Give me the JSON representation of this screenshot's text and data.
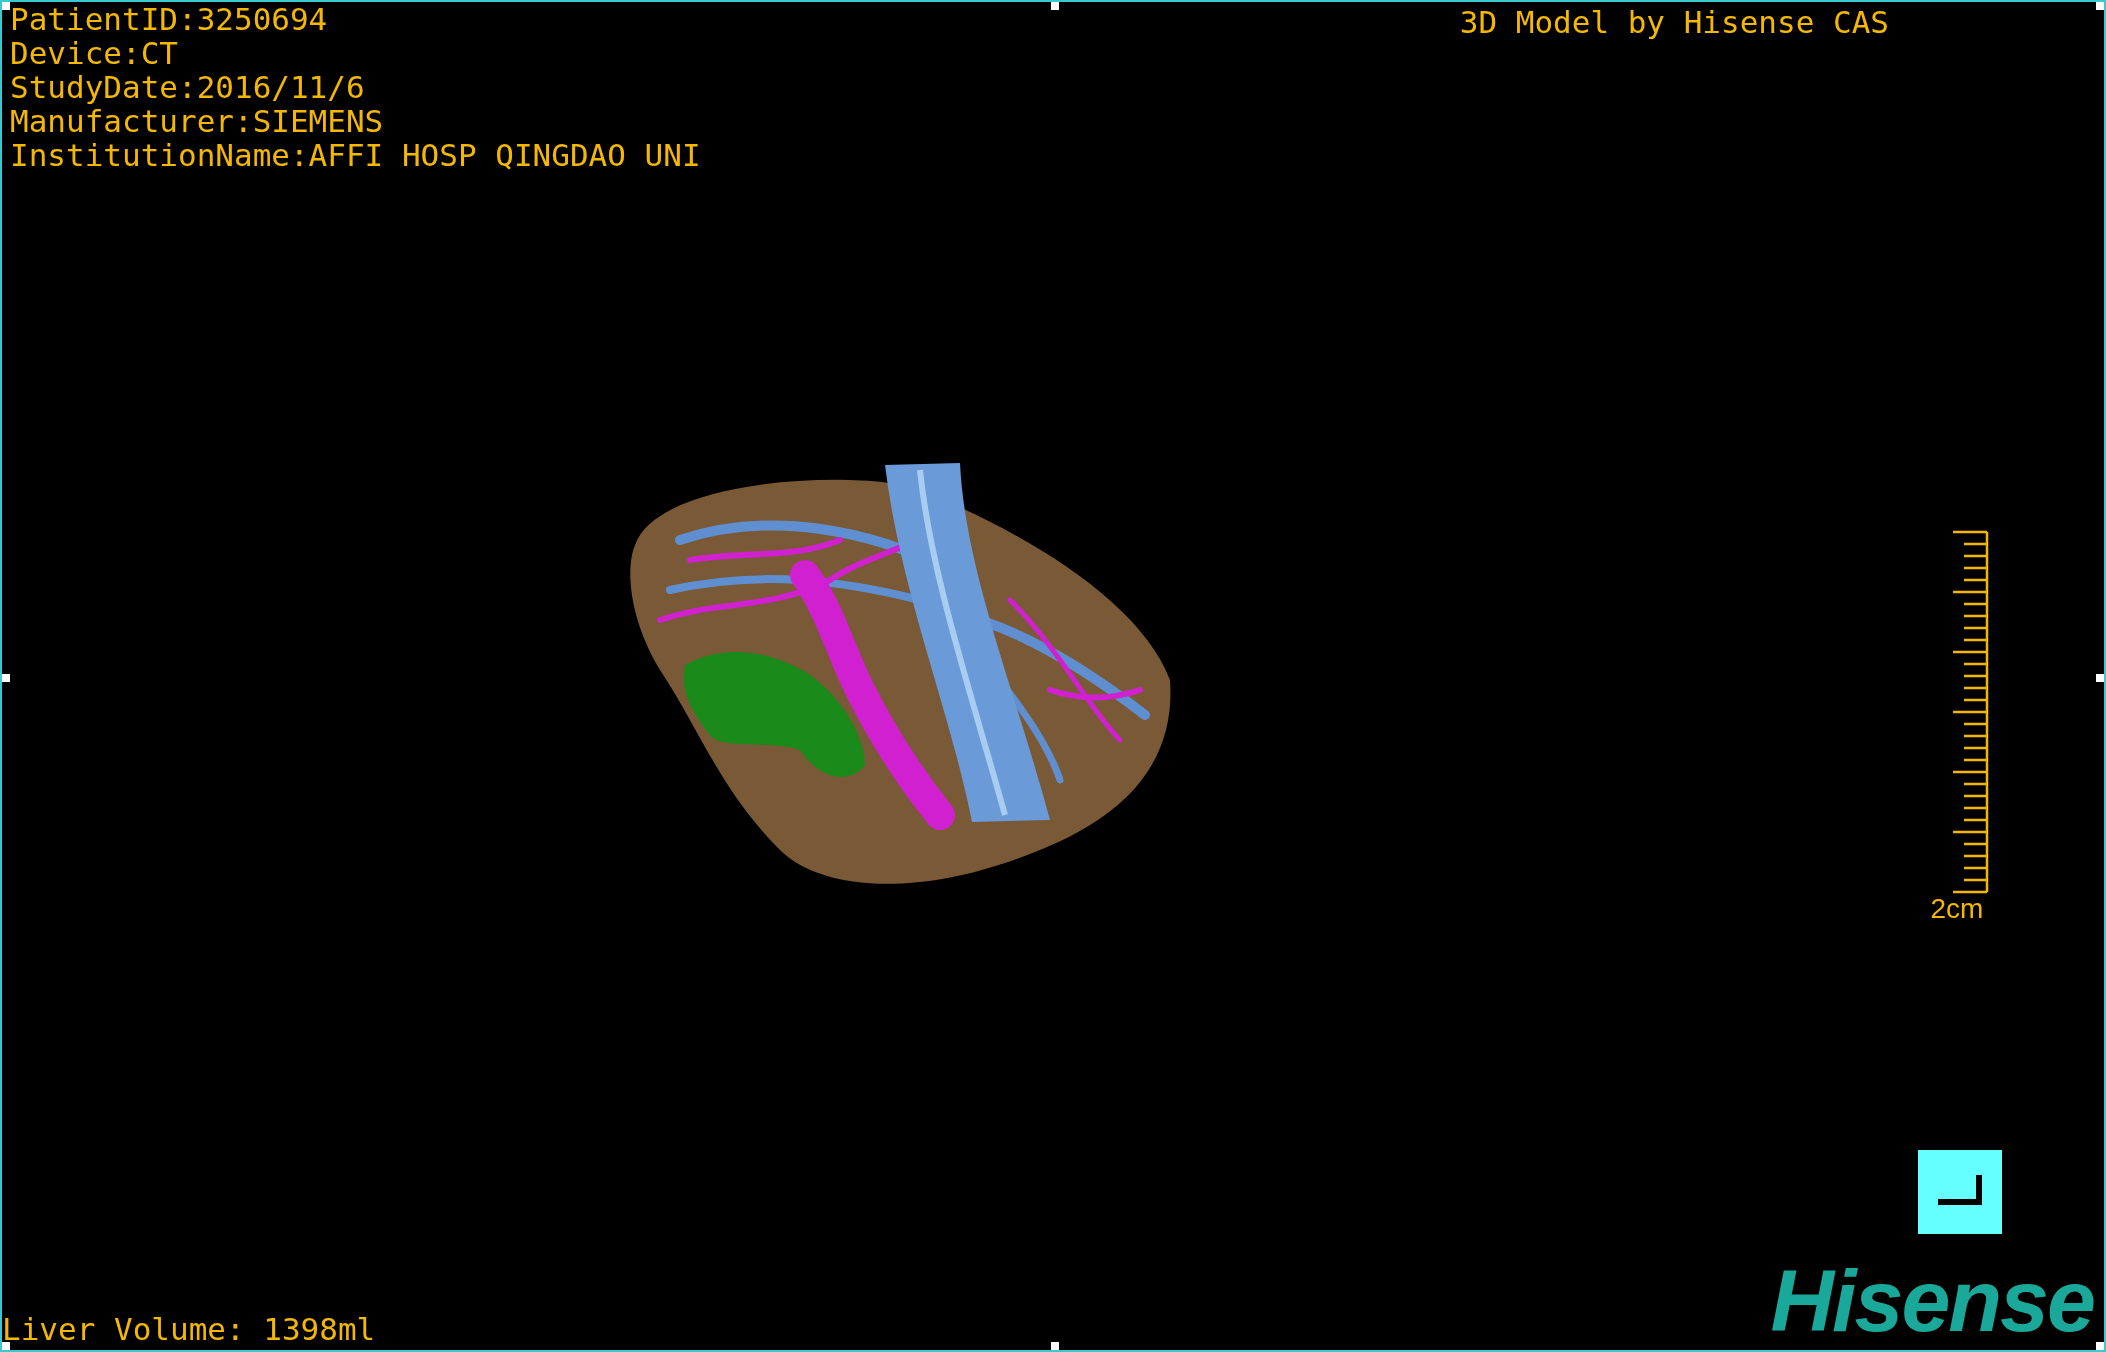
{
  "info_lines": [
    "PatientID:3250694",
    "Device:CT",
    "StudyDate:2016/11/6",
    "Manufacturer:SIEMENS",
    "InstitutionName:AFFI HOSP QINGDAO UNI"
  ],
  "title": "3D Model by Hisense CAS",
  "scale_bar": {
    "label": "2cm"
  },
  "liver_volume": "Liver Volume: 1398ml",
  "logo": "Hisense"
}
